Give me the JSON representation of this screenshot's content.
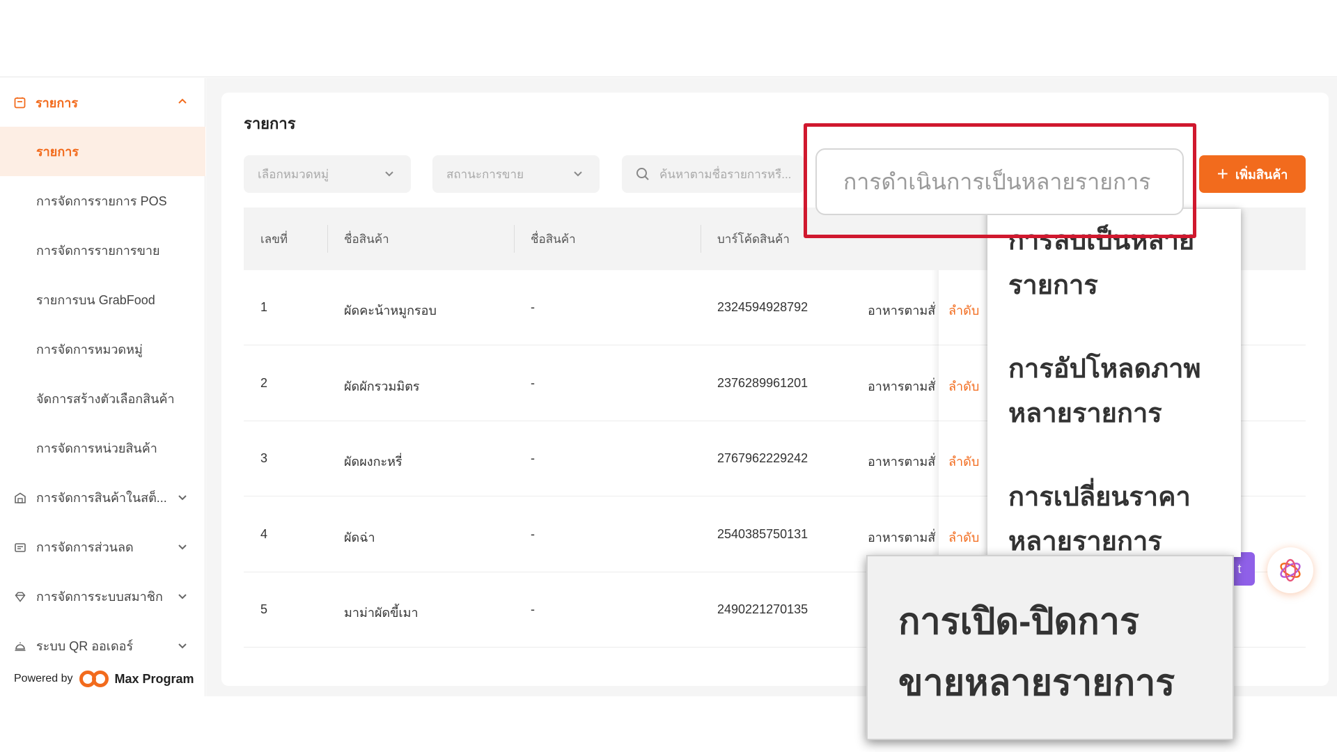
{
  "sidebar": {
    "section_title": "รายการ",
    "subitems": [
      {
        "label": "รายการ",
        "active": true
      },
      {
        "label": "การจัดการรายการ POS"
      },
      {
        "label": "การจัดการรายการขาย"
      },
      {
        "label": "รายการบน GrabFood"
      },
      {
        "label": "การจัดการหมวดหมู่"
      },
      {
        "label": "จัดการสร้างตัวเลือกสินค้า"
      },
      {
        "label": "การจัดการหน่วยสินค้า"
      }
    ],
    "groups": [
      {
        "label": "การจัดการสินค้าในสต็...",
        "icon": "warehouse-icon"
      },
      {
        "label": "การจัดการส่วนลด",
        "icon": "ticket-icon"
      },
      {
        "label": "การจัดการระบบสมาชิก",
        "icon": "gem-icon"
      },
      {
        "label": "ระบบ QR ออเดอร์",
        "icon": "service-bell-icon"
      }
    ],
    "powered_by": "Powered by",
    "brand": "Max Program"
  },
  "main": {
    "title": "รายการ",
    "filters": {
      "category_placeholder": "เลือกหมวดหมู่",
      "status_placeholder": "สถานะการขาย",
      "search_placeholder": "ค้นหาตามชื่อรายการหรื..."
    },
    "bulk_button_label": "การดำเนินการเป็นหลายรายการ",
    "add_button_label": "เพิ่มสินค้า",
    "table": {
      "headers": [
        "เลขที่",
        "ชื่อสินค้า",
        "ชื่อสินค้า",
        "บาร์โค้ดสินค้า"
      ],
      "rows": [
        {
          "no": "1",
          "name": "ผัดคะน้าหมูกรอบ",
          "alt_name": "-",
          "barcode": "2324594928792",
          "category": "อาหารตามสั่ง",
          "action": "ลำดับ"
        },
        {
          "no": "2",
          "name": "ผัดผักรวมมิตร",
          "alt_name": "-",
          "barcode": "2376289961201",
          "category": "อาหารตามสั่ง",
          "action": "ลำดับ"
        },
        {
          "no": "3",
          "name": "ผัดผงกะหรี่",
          "alt_name": "-",
          "barcode": "2767962229242",
          "category": "อาหารตามสั่ง",
          "action": "ลำดับ"
        },
        {
          "no": "4",
          "name": "ผัดฉ่า",
          "alt_name": "-",
          "barcode": "2540385750131",
          "category": "อาหารตามสั่ง",
          "action": "ลำดับ"
        },
        {
          "no": "5",
          "name": "มาม่าผัดขี้เมา",
          "alt_name": "-",
          "barcode": "2490221270135",
          "category": "",
          "action": ""
        }
      ]
    },
    "dropdown": {
      "items": [
        "การลบเป็นหลายรายการ",
        "การอัปโหลดภาพหลายรายการ",
        "การเปลี่ยนราคาหลายรายการ"
      ]
    },
    "zoom_callout": {
      "line1": "การเปิด-ปิดการ",
      "line2": "ขายหลายรายการ"
    },
    "chip_label": "t"
  },
  "colors": {
    "accent": "#f26b1d",
    "highlight_frame": "#d0182e",
    "active_bg": "#fdeee4",
    "chip": "#8f60e8"
  }
}
